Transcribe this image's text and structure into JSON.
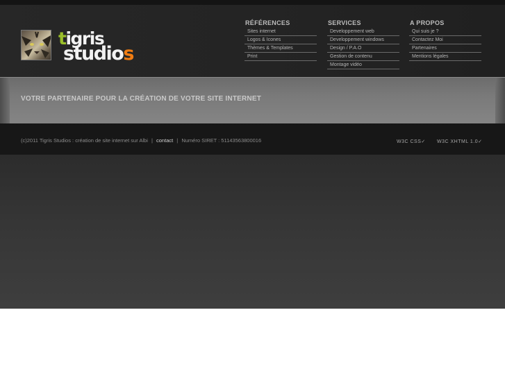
{
  "logo": {
    "tigris": "tigris",
    "studios": "studios"
  },
  "menu": {
    "references": {
      "heading": "RÉFÉRENCES",
      "items": [
        "Sites internet",
        "Logos & Icones",
        "Thèmes & Templates",
        "Print"
      ]
    },
    "services": {
      "heading": "SERVICES",
      "items": [
        "Developpement web",
        "Developpement windows",
        "Design / P.A.O",
        "Gestion de contenu",
        "Montage vidéo"
      ]
    },
    "apropos": {
      "heading": "A PROPOS",
      "items": [
        "Qui suis je ?",
        "Contactez Moi",
        "Partenaires",
        "Mentions légales"
      ]
    }
  },
  "banner": {
    "tagline": "VOTRE PARTENAIRE POUR LA CRÉATION DE VOTRE SITE INTERNET"
  },
  "footer": {
    "copyright": "(c)2011 Tigris Studios : création de site internet sur Albi",
    "separator": "|",
    "contact": "contact",
    "siret": "Numéro SIRET : 51143563800016",
    "w3c_css": "W3C CSS✓",
    "w3c_xhtml": "W3C XHTML 1.0✓"
  },
  "colors": {
    "accent_green": "#9bbf2a",
    "accent_orange": "#f07c12",
    "header_bg": "#252525",
    "footer_bg": "#171717"
  }
}
